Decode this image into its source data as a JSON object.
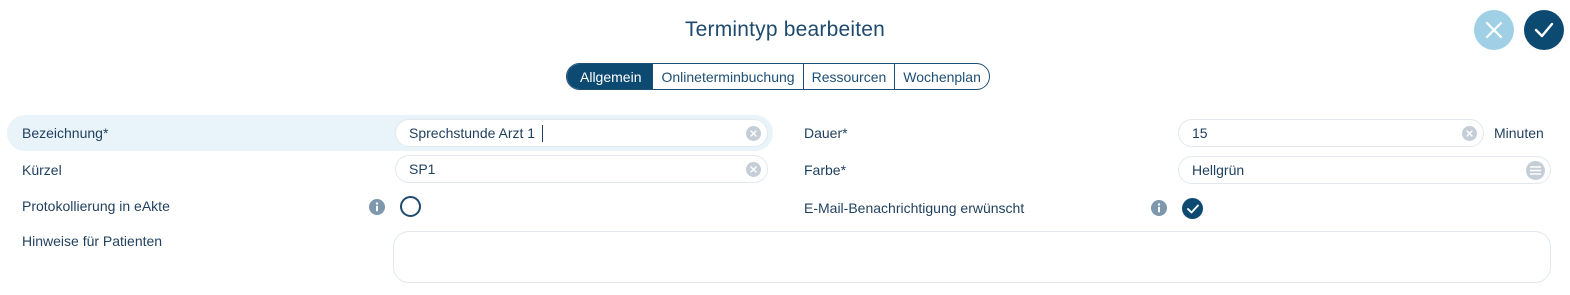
{
  "dialog": {
    "title": "Termintyp bearbeiten"
  },
  "tabs": [
    {
      "label": "Allgemein",
      "active": true
    },
    {
      "label": "Onlineterminbuchung",
      "active": false
    },
    {
      "label": "Ressourcen",
      "active": false
    },
    {
      "label": "Wochenplan",
      "active": false
    }
  ],
  "form": {
    "bezeichnung": {
      "label": "Bezeichnung*",
      "value": "Sprechstunde Arzt 1"
    },
    "kuerzel": {
      "label": "Kürzel",
      "value": "SP1"
    },
    "protokollierung": {
      "label": "Protokollierung in eAkte",
      "checked": false
    },
    "hinweise": {
      "label": "Hinweise für Patienten",
      "value": ""
    },
    "dauer": {
      "label": "Dauer*",
      "value": "15",
      "unit": "Minuten"
    },
    "farbe": {
      "label": "Farbe*",
      "value": "Hellgrün"
    },
    "email": {
      "label": "E-Mail-Benachrichtigung erwünscht",
      "checked": true
    }
  },
  "colors": {
    "primary": "#0d4a72",
    "cancel": "#9fd0e6",
    "row_highlight": "#e8f3fa",
    "text": "#1f3f5e"
  },
  "icons": {
    "cancel": "close-icon",
    "confirm": "checkmark-icon",
    "clear": "clear-icon",
    "info": "info-icon",
    "menu": "list-icon"
  }
}
